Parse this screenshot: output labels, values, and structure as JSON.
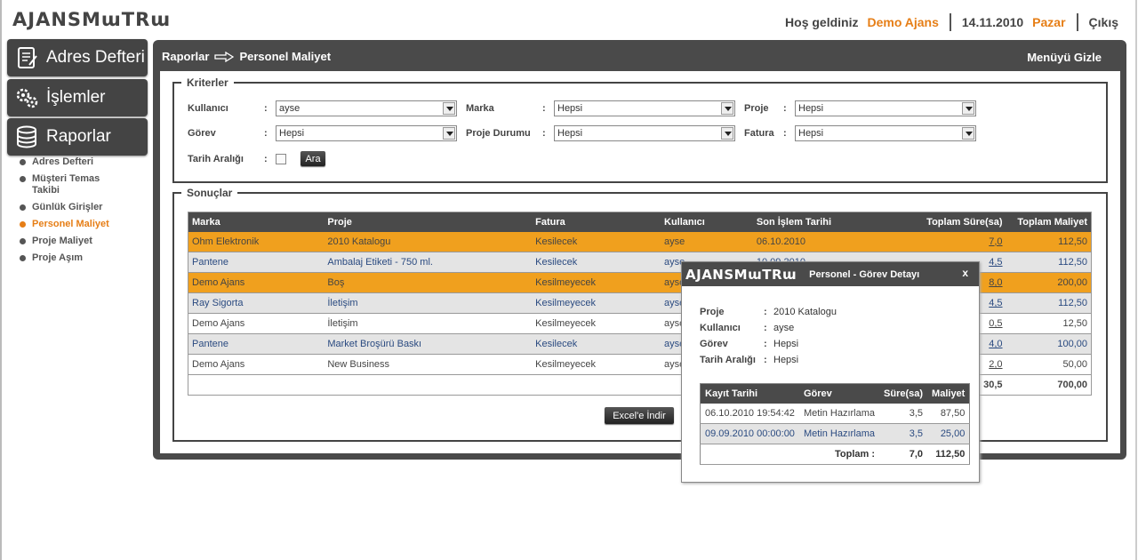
{
  "header": {
    "logo": "AJANSMɯTRɯ",
    "welcome": "Hoş geldiniz",
    "user": "Demo Ajans",
    "date": "14.11.2010",
    "day": "Pazar",
    "logout": "Çıkış"
  },
  "nav": {
    "buttons": [
      {
        "label": "Adres Defteri",
        "icon": "address-book-icon"
      },
      {
        "label": "İşlemler",
        "icon": "gears-icon"
      },
      {
        "label": "Raporlar",
        "icon": "database-icon"
      }
    ],
    "subitems": [
      {
        "label": "Adres Defteri",
        "active": false
      },
      {
        "label": "Müşteri Temas Takibi",
        "active": false
      },
      {
        "label": "Günlük Girişler",
        "active": false
      },
      {
        "label": "Personel Maliyet",
        "active": true
      },
      {
        "label": "Proje Maliyet",
        "active": false
      },
      {
        "label": "Proje Aşım",
        "active": false
      }
    ]
  },
  "panel": {
    "breadcrumb_root": "Raporlar",
    "breadcrumb_current": "Personel Maliyet",
    "hide_menu": "Menüyü Gizle"
  },
  "criteria": {
    "legend": "Kriterler",
    "kullanici_label": "Kullanıcı",
    "kullanici_value": "ayse",
    "marka_label": "Marka",
    "marka_value": "Hepsi",
    "proje_label": "Proje",
    "proje_value": "Hepsi",
    "gorev_label": "Görev",
    "gorev_value": "Hepsi",
    "proje_durumu_label": "Proje Durumu",
    "proje_durumu_value": "Hepsi",
    "fatura_label": "Fatura",
    "fatura_value": "Hepsi",
    "tarih_label": "Tarih Aralığı",
    "search_button": "Ara",
    "colon": ":"
  },
  "results": {
    "legend": "Sonuçlar",
    "columns": [
      "Marka",
      "Proje",
      "Fatura",
      "Kullanıcı",
      "Son İşlem Tarihi",
      "Toplam Süre(sa)",
      "Toplam Maliyet"
    ],
    "rows": [
      {
        "marka": "Ohm Elektronik",
        "proje": "2010 Katalogu",
        "fatura": "Kesilecek",
        "kullanici": "ayse",
        "tarih": "06.10.2010",
        "sure": "7,0",
        "maliyet": "112,50",
        "style": "orange"
      },
      {
        "marka": "Pantene",
        "proje": "Ambalaj Etiketi - 750 ml.",
        "fatura": "Kesilecek",
        "kullanici": "ayse",
        "tarih": "10.09.2010",
        "sure": "4,5",
        "maliyet": "112,50",
        "style": "grey"
      },
      {
        "marka": "Demo Ajans",
        "proje": "Boş",
        "fatura": "Kesilmeyecek",
        "kullanici": "ayse",
        "tarih": "",
        "sure": "8,0",
        "maliyet": "200,00",
        "style": "orange"
      },
      {
        "marka": "Ray Sigorta",
        "proje": "İletişim",
        "fatura": "Kesilmeyecek",
        "kullanici": "ayse",
        "tarih": "",
        "sure": "4,5",
        "maliyet": "112,50",
        "style": "grey"
      },
      {
        "marka": "Demo Ajans",
        "proje": "İletişim",
        "fatura": "Kesilmeyecek",
        "kullanici": "ayse",
        "tarih": "",
        "sure": "0,5",
        "maliyet": "12,50",
        "style": "white"
      },
      {
        "marka": "Pantene",
        "proje": "Market Broşürü Baskı",
        "fatura": "Kesilecek",
        "kullanici": "ayse",
        "tarih": "",
        "sure": "4,0",
        "maliyet": "100,00",
        "style": "grey"
      },
      {
        "marka": "Demo Ajans",
        "proje": "New Business",
        "fatura": "Kesilmeyecek",
        "kullanici": "ayse",
        "tarih": "",
        "sure": "2,0",
        "maliyet": "50,00",
        "style": "white"
      }
    ],
    "total_sure": "30,5",
    "total_maliyet": "700,00",
    "excel_button": "Excel'e İndir"
  },
  "popup": {
    "logo": "AJANSMɯTRɯ",
    "title": "Personel - Görev Detayı",
    "close": "x",
    "fields": [
      {
        "label": "Proje",
        "value": "2010 Katalogu"
      },
      {
        "label": "Kullanıcı",
        "value": "ayse"
      },
      {
        "label": "Görev",
        "value": "Hepsi"
      },
      {
        "label": "Tarih Aralığı",
        "value": "Hepsi"
      }
    ],
    "columns": [
      "Kayıt Tarihi",
      "Görev",
      "Süre(sa)",
      "Maliyet"
    ],
    "rows": [
      {
        "tarih": "06.10.2010 19:54:42",
        "gorev": "Metin Hazırlama",
        "sure": "3,5",
        "maliyet": "87,50",
        "style": "white"
      },
      {
        "tarih": "09.09.2010 00:00:00",
        "gorev": "Metin Hazırlama",
        "sure": "3,5",
        "maliyet": "25,00",
        "style": "grey"
      }
    ],
    "total_label": "Toplam :",
    "total_sure": "7,0",
    "total_maliyet": "112,50"
  },
  "colors": {
    "accent": "#e67e16",
    "highlight_row": "#f0a01e",
    "dark": "#4a4a4a",
    "link": "#2a4a80"
  }
}
